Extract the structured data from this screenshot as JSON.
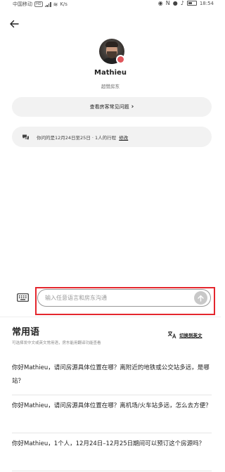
{
  "status_bar": {
    "carrier": "中国移动",
    "hd": "HD",
    "speed": "K/s",
    "time": "18:54"
  },
  "host": {
    "name": "Mathieu",
    "role": "超赞房东"
  },
  "faq_button": {
    "label": "查看房客常见问题",
    "chevron": "›"
  },
  "trip": {
    "text": "你问的是12月24日至25日 · 1人的行程",
    "edit_label": "修改"
  },
  "composer": {
    "placeholder": "输入任意语言和房东沟通"
  },
  "phrases": {
    "title": "常用语",
    "subtitle": "可选择发中文或英文常用语，房东能用翻译功能查看",
    "switch_label": "切换到英文",
    "items": [
      "你好Mathieu，请问房源具体位置在哪？离附近的地铁或公交站多远，是哪站？",
      "你好Mathieu，请问房源具体位置在哪？离机场/火车站多远，怎么去方便？",
      "你好Mathieu，1个人，12月24日–12月25日期间可以预订这个房源吗？"
    ]
  },
  "icons": {
    "back": "arrow-left-icon",
    "keyboard": "keyboard-icon",
    "send": "arrow-up-icon",
    "chat": "chat-bubbles-icon",
    "translate": "translate-icon"
  },
  "colors": {
    "highlight": "#e4262d",
    "superhost_badge": "#e0565b",
    "pill_bg": "#f2f2f2"
  }
}
